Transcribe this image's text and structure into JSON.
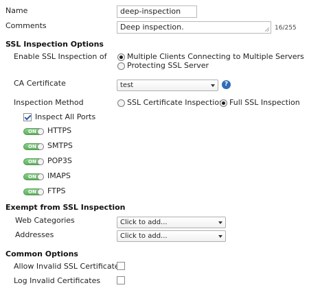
{
  "name": {
    "label": "Name",
    "value": "deep-inspection"
  },
  "comments": {
    "label": "Comments",
    "value": "Deep inspection.",
    "counter": "16/255"
  },
  "ssl_inspection_options": {
    "title": "SSL Inspection Options",
    "enable_label": "Enable SSL Inspection of",
    "enable_options": [
      {
        "label": "Multiple Clients Connecting to Multiple Servers",
        "selected": true
      },
      {
        "label": "Protecting SSL Server",
        "selected": false
      }
    ],
    "ca_certificate": {
      "label": "CA Certificate",
      "value": "test",
      "help_icon": "question-mark-icon"
    },
    "inspection_method": {
      "label": "Inspection Method",
      "options": [
        {
          "label": "SSL Certificate Inspection",
          "selected": false
        },
        {
          "label": "Full SSL Inspection",
          "selected": true
        }
      ]
    },
    "inspect_all_ports": {
      "label": "Inspect All Ports",
      "checked": true
    },
    "protocols": [
      {
        "toggle_text": "ON",
        "label": "HTTPS"
      },
      {
        "toggle_text": "ON",
        "label": "SMTPS"
      },
      {
        "toggle_text": "ON",
        "label": "POP3S"
      },
      {
        "toggle_text": "ON",
        "label": "IMAPS"
      },
      {
        "toggle_text": "ON",
        "label": "FTPS"
      }
    ]
  },
  "exempt": {
    "title": "Exempt from SSL Inspection",
    "web_categories": {
      "label": "Web Categories",
      "value": "Click to add..."
    },
    "addresses": {
      "label": "Addresses",
      "value": "Click to add..."
    }
  },
  "common_options": {
    "title": "Common Options",
    "allow_invalid": {
      "label": "Allow Invalid SSL Certificates",
      "checked": false
    },
    "log_invalid": {
      "label": "Log Invalid Certificates",
      "checked": false
    }
  },
  "colors": {
    "toggle_on": "#5fb15f",
    "help_icon": "#2f6db5"
  }
}
